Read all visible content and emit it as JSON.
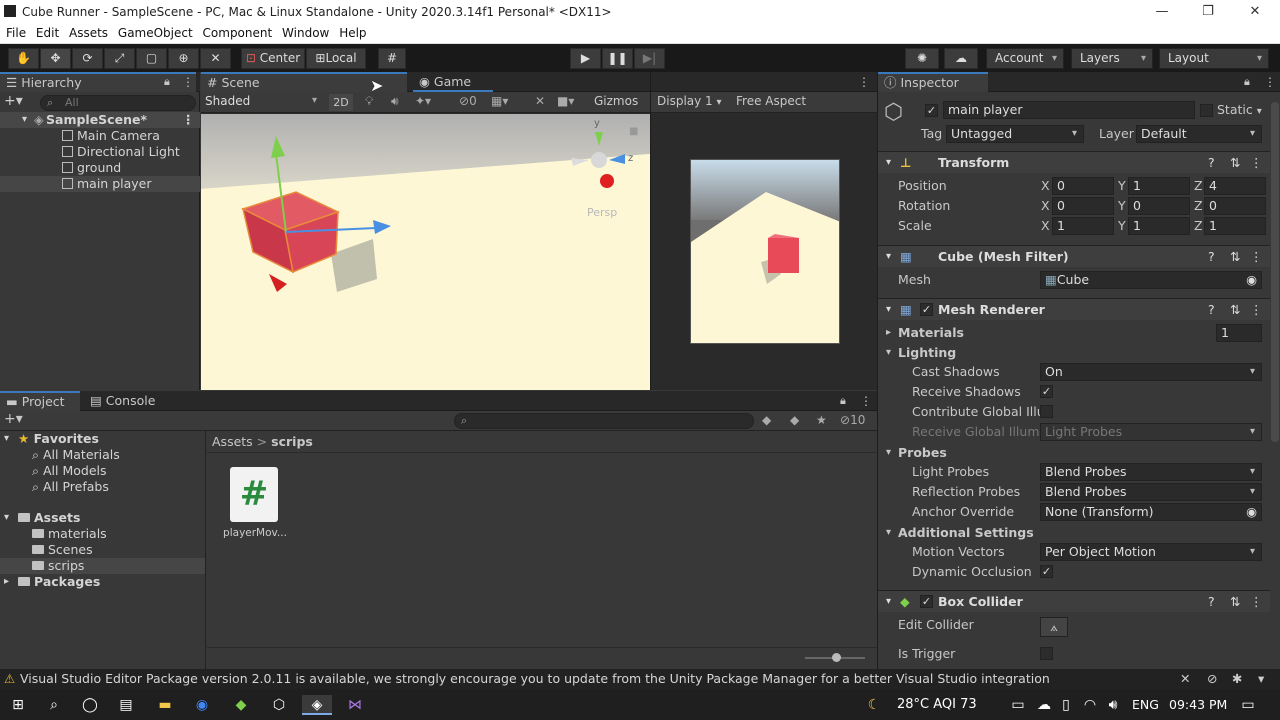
{
  "window": {
    "title": "Cube Runner - SampleScene - PC, Mac & Linux Standalone - Unity 2020.3.14f1 Personal* <DX11>",
    "minimize": "—",
    "restore": "❐",
    "close": "✕"
  },
  "menu": [
    "File",
    "Edit",
    "Assets",
    "GameObject",
    "Component",
    "Window",
    "Help"
  ],
  "toolbar": {
    "pivot": "Center",
    "space": "Local",
    "account": "Account",
    "layers": "Layers",
    "layout": "Layout"
  },
  "hierarchy": {
    "tab": "Hierarchy",
    "search_placeholder": "All",
    "scene": "SampleScene*",
    "items": [
      "Main Camera",
      "Directional Light",
      "ground",
      "main player"
    ]
  },
  "scene": {
    "tab": "Scene",
    "shading": "Shaded",
    "mode2d": "2D",
    "hidden_count": "0",
    "gizmos": "Gizmos",
    "persp": "Persp",
    "axis_y": "y",
    "axis_z": "z"
  },
  "game": {
    "tab": "Game",
    "display": "Display 1",
    "aspect": "Free Aspect"
  },
  "inspector": {
    "tab": "Inspector",
    "object_name": "main player",
    "static_label": "Static",
    "tag_label": "Tag",
    "tag_value": "Untagged",
    "layer_label": "Layer",
    "layer_value": "Default",
    "transform": {
      "title": "Transform",
      "position_label": "Position",
      "rotation_label": "Rotation",
      "scale_label": "Scale",
      "position": [
        "0",
        "1",
        "4"
      ],
      "rotation": [
        "0",
        "0",
        "0"
      ],
      "scale": [
        "1",
        "1",
        "1"
      ],
      "x": "X",
      "y": "Y",
      "z": "Z"
    },
    "mesh_filter": {
      "title": "Cube (Mesh Filter)",
      "mesh_label": "Mesh",
      "mesh_value": "Cube"
    },
    "mesh_renderer": {
      "title": "Mesh Renderer",
      "materials_label": "Materials",
      "materials_count": "1",
      "lighting_label": "Lighting",
      "cast_shadows_label": "Cast Shadows",
      "cast_shadows_value": "On",
      "receive_shadows_label": "Receive Shadows",
      "contribute_gi_label": "Contribute Global Illun",
      "receive_gi_label": "Receive Global Illumi",
      "receive_gi_value": "Light Probes",
      "probes_label": "Probes",
      "light_probes_label": "Light Probes",
      "light_probes_value": "Blend Probes",
      "reflection_probes_label": "Reflection Probes",
      "reflection_probes_value": "Blend Probes",
      "anchor_override_label": "Anchor Override",
      "anchor_override_value": "None (Transform)",
      "additional_label": "Additional Settings",
      "motion_vectors_label": "Motion Vectors",
      "motion_vectors_value": "Per Object Motion",
      "dynamic_occlusion_label": "Dynamic Occlusion"
    },
    "box_collider": {
      "title": "Box Collider",
      "edit_collider_label": "Edit Collider",
      "is_trigger_label": "Is Trigger"
    }
  },
  "project": {
    "tab": "Project",
    "console_tab": "Console",
    "favorites": "Favorites",
    "fav_items": [
      "All Materials",
      "All Models",
      "All Prefabs"
    ],
    "assets": "Assets",
    "asset_folders": [
      "materials",
      "Scenes",
      "scrips"
    ],
    "packages": "Packages",
    "breadcrumb_root": "Assets",
    "breadcrumb_sep": ">",
    "breadcrumb_current": "scrips",
    "file_name": "playerMov...",
    "hidden_count": "10"
  },
  "status": {
    "message": "Visual Studio Editor Package version 2.0.11 is available, we strongly encourage you to update from the Unity Package Manager for a better Visual Studio integration"
  },
  "taskbar": {
    "weather": "28°C  AQI 73",
    "lang": "ENG",
    "time": "09:43 PM"
  },
  "colors": {
    "accent": "#3a79bb",
    "cube": "#d03a4a",
    "sky": "#c9dcea",
    "ground": "#fdf7d6"
  }
}
